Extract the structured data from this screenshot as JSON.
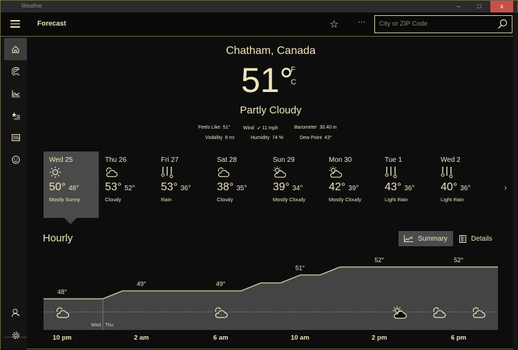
{
  "window": {
    "title": "Weather",
    "minimize": "–",
    "maximize": "□",
    "close": "x",
    "close_color": "#c8504b"
  },
  "header": {
    "title": "Forecast",
    "favorite_icon": "star-icon",
    "more": "···",
    "search_placeholder": "City or ZIP Code",
    "search_value": ""
  },
  "sidebar": {
    "items": [
      {
        "name": "home",
        "icon": "home-icon",
        "selected": true
      },
      {
        "name": "maps",
        "icon": "radar-icon"
      },
      {
        "name": "historical-weather",
        "icon": "chart-icon"
      },
      {
        "name": "places",
        "icon": "star-list-icon"
      },
      {
        "name": "news",
        "icon": "news-icon"
      },
      {
        "name": "life",
        "icon": "smiley-icon"
      }
    ],
    "bottom": [
      {
        "name": "account",
        "icon": "person-icon"
      },
      {
        "name": "settings",
        "icon": "gear-icon"
      }
    ]
  },
  "current": {
    "location": "Chatham, Canada",
    "temperature": "51°",
    "unit_f": "F",
    "unit_c": "C",
    "condition": "Partly Cloudy",
    "details": {
      "feels_like_label": "Feels Like",
      "feels_like": "51°",
      "wind_label": "Wind",
      "wind": "11 mph",
      "barometer_label": "Barometer",
      "barometer": "30.40 in",
      "visibility_label": "Visibility",
      "visibility": "8 mi",
      "humidity_label": "Humidity",
      "humidity": "74 %",
      "dew_point_label": "Dew Point",
      "dew_point": "43°"
    }
  },
  "daily": [
    {
      "day": "Wed 25",
      "icon": "sun",
      "high": "50°",
      "low": "48°",
      "condition": "Mostly Sunny",
      "selected": true
    },
    {
      "day": "Thu 26",
      "icon": "cloudy",
      "high": "53°",
      "low": "52°",
      "condition": "Cloudy"
    },
    {
      "day": "Fri 27",
      "icon": "rain",
      "high": "53°",
      "low": "36°",
      "condition": "Rain"
    },
    {
      "day": "Sat 28",
      "icon": "cloudy",
      "high": "38°",
      "low": "35°",
      "condition": "Cloudy"
    },
    {
      "day": "Sun 29",
      "icon": "mostly-cloudy",
      "high": "39°",
      "low": "34°",
      "condition": "Mostly Cloudy"
    },
    {
      "day": "Mon 30",
      "icon": "mostly-cloudy",
      "high": "42°",
      "low": "39°",
      "condition": "Mostly Cloudy"
    },
    {
      "day": "Tue 1",
      "icon": "rain",
      "high": "43°",
      "low": "36°",
      "condition": "Light Rain"
    },
    {
      "day": "Wed 2",
      "icon": "rain",
      "high": "40°",
      "low": "36°",
      "condition": "Light Rain"
    }
  ],
  "hourly": {
    "title": "Hourly",
    "summary_label": "Summary",
    "details_label": "Details",
    "view": "Summary",
    "temps": [
      48,
      48,
      48,
      49,
      49,
      49,
      49,
      49,
      49,
      49,
      50,
      50,
      51,
      51,
      52,
      52,
      52,
      52,
      52,
      52,
      52,
      52,
      52
    ],
    "temp_labels": [
      {
        "hour_index": 0,
        "text": "48°"
      },
      {
        "hour_index": 4,
        "text": "49°"
      },
      {
        "hour_index": 8,
        "text": "49°"
      },
      {
        "hour_index": 12,
        "text": "51°"
      },
      {
        "hour_index": 16,
        "text": "52°"
      },
      {
        "hour_index": 20,
        "text": "52°"
      }
    ],
    "time_labels": [
      {
        "hour_index": 0,
        "text": "10 pm"
      },
      {
        "hour_index": 4,
        "text": "2 am"
      },
      {
        "hour_index": 8,
        "text": "6 am"
      },
      {
        "hour_index": 12,
        "text": "10 am"
      },
      {
        "hour_index": 16,
        "text": "2 pm"
      },
      {
        "hour_index": 20,
        "text": "6 pm"
      }
    ],
    "icons": [
      {
        "hour_index": 0,
        "icon": "cloudy"
      },
      {
        "hour_index": 8,
        "icon": "cloudy"
      },
      {
        "hour_index": 17,
        "icon": "mostly-cloudy"
      },
      {
        "hour_index": 19,
        "icon": "cloudy"
      },
      {
        "hour_index": 21,
        "icon": "cloudy"
      }
    ],
    "day_divider": {
      "before": "Wed",
      "after": "Thu"
    }
  },
  "colors": {
    "accent": "#efe4bd",
    "selected": "#4a4a4a",
    "chart_fill": "#444444",
    "chart_line": "#c9bf95"
  }
}
